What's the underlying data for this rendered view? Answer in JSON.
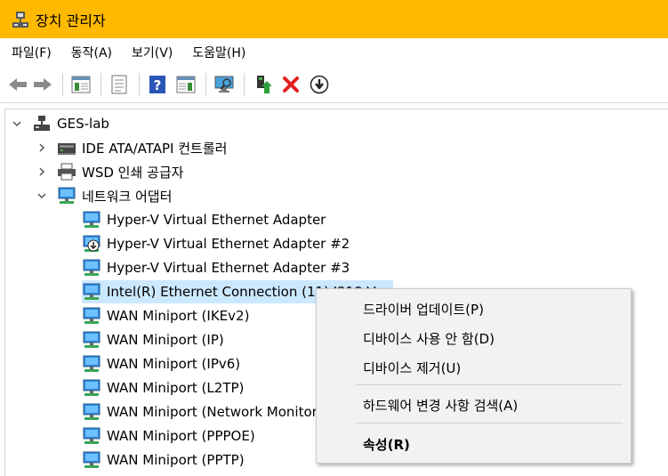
{
  "window": {
    "title": "장치 관리자",
    "accent": "#ffb900"
  },
  "menubar": {
    "items": [
      "파일(F)",
      "동작(A)",
      "보기(V)",
      "도움말(H)"
    ]
  },
  "toolbar": {
    "buttons": [
      "back-icon",
      "forward-icon",
      "show-hide-tree-icon",
      "properties-icon",
      "help-icon",
      "action-pane-icon",
      "scan-hardware-icon",
      "update-driver-icon",
      "uninstall-icon",
      "disable-icon"
    ]
  },
  "tree": {
    "root": "GES-lab",
    "categories": [
      {
        "label": "IDE ATA/ATAPI 컨트롤러",
        "expanded": false
      },
      {
        "label": "WSD 인쇄 공급자",
        "expanded": false
      },
      {
        "label": "네트워크 어댑터",
        "expanded": true
      }
    ],
    "adapters": [
      "Hyper-V Virtual Ethernet Adapter",
      "Hyper-V Virtual Ethernet Adapter #2",
      "Hyper-V Virtual Ethernet Adapter #3",
      "Intel(R) Ethernet Connection (11) I219-V",
      "WAN Miniport (IKEv2)",
      "WAN Miniport (IP)",
      "WAN Miniport (IPv6)",
      "WAN Miniport (L2TP)",
      "WAN Miniport (Network Monitor)",
      "WAN Miniport (PPPOE)",
      "WAN Miniport (PPTP)"
    ],
    "selected_index": 3
  },
  "context_menu": {
    "update_driver": "드라이버 업데이트(P)",
    "disable_device": "디바이스 사용 안 함(D)",
    "uninstall_device": "디바이스 제거(U)",
    "scan_hardware": "하드웨어 변경 사항 검색(A)",
    "properties": "속성(R)"
  }
}
